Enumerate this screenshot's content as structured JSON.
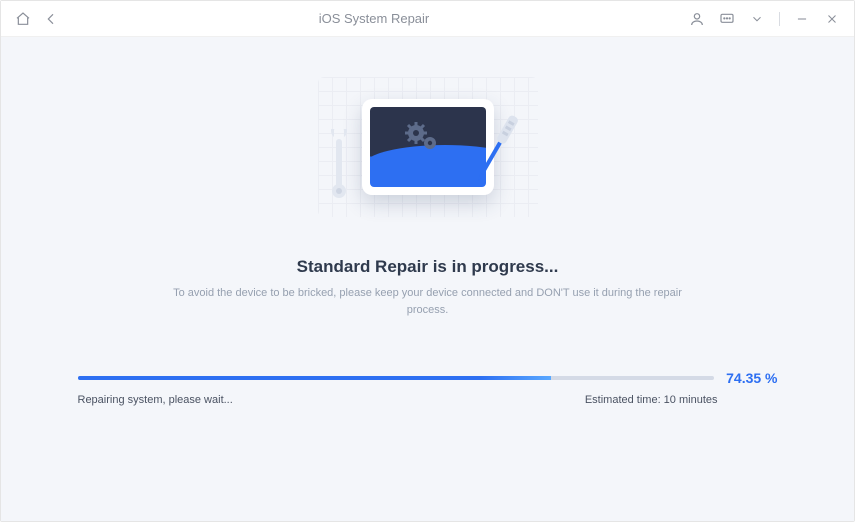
{
  "titlebar": {
    "title": "iOS System Repair"
  },
  "main": {
    "heading": "Standard Repair is in progress...",
    "subtext": "To avoid the device to be bricked, please keep your device connected and DON'T use it during the repair process."
  },
  "progress": {
    "percent_text": "74.35 %",
    "percent_value": 74.35,
    "status": "Repairing system, please wait...",
    "estimated": "Estimated time: 10 minutes"
  }
}
